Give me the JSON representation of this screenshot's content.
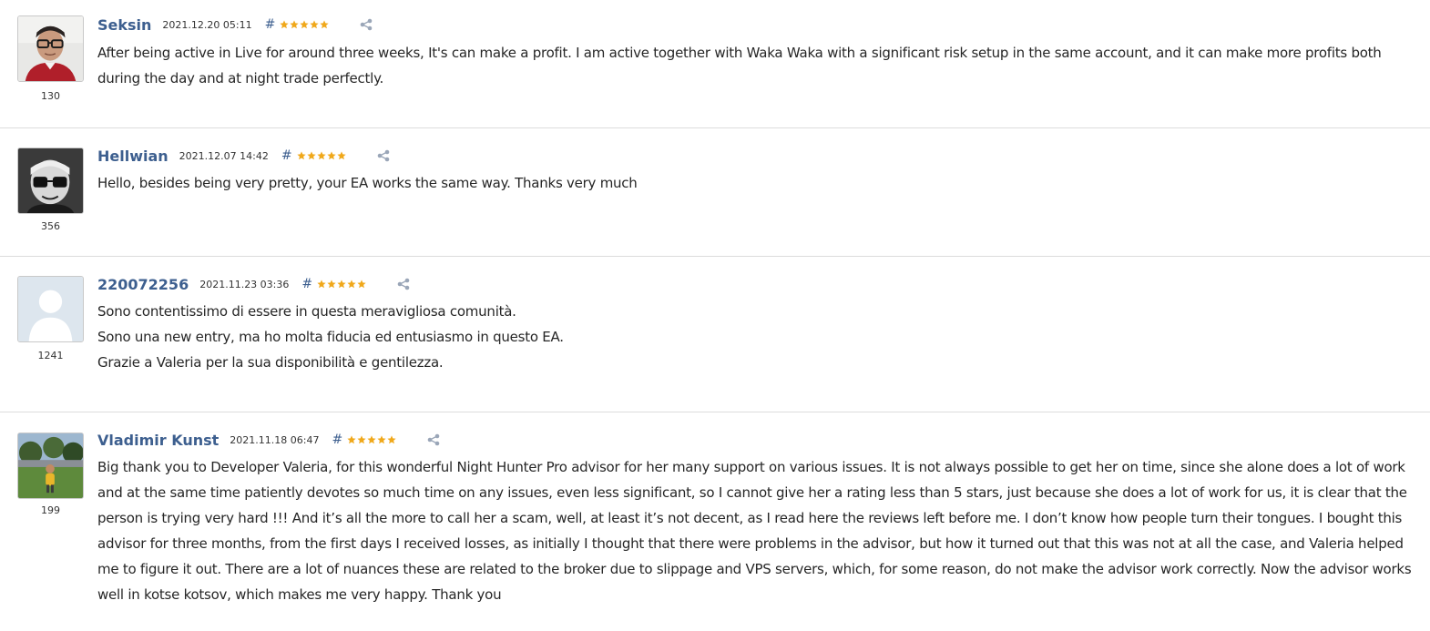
{
  "reviews": [
    {
      "author": "Seksin",
      "date": "2021.12.20 05:11",
      "hash": "#",
      "rating": 5,
      "author_count": "130",
      "avatar_icon": "person-glasses-photo",
      "lines": [
        "After being active in Live for around three weeks, It's can make a profit. I am active together with Waka Waka with a significant risk setup in the same account, and it can make more profits both during the day and at night trade perfectly."
      ]
    },
    {
      "author": "Hellwian",
      "date": "2021.12.07 14:42",
      "hash": "#",
      "rating": 5,
      "author_count": "356",
      "avatar_icon": "bw-portrait-photo",
      "lines": [
        "Hello, besides being very pretty, your EA works the same way. Thanks very much"
      ]
    },
    {
      "author": "220072256",
      "date": "2021.11.23 03:36",
      "hash": "#",
      "rating": 5,
      "author_count": "1241",
      "avatar_icon": "default-user-silhouette",
      "lines": [
        "Sono contentissimo di essere in questa meravigliosa comunità.",
        "Sono una new entry, ma ho molta fiducia ed entusiasmo in questo EA.",
        "Grazie a Valeria per la sua disponibilità e gentilezza."
      ]
    },
    {
      "author": "Vladimir Kunst",
      "date": "2021.11.18 06:47",
      "hash": "#",
      "rating": 5,
      "author_count": "199",
      "avatar_icon": "outdoor-child-photo",
      "lines": [
        "Big thank you to Developer Valeria, for this wonderful Night Hunter Pro advisor for her many support on various issues. It is not always possible to get her on time, since she alone does a lot of work and at the same time patiently devotes so much time on any issues, even less significant, so I cannot give her a rating less than 5 stars, just because she does a lot of work for us, it is clear that the person is trying very hard !!! And it’s all the more to call her a scam, well, at least it’s not decent, as I read here the reviews left before me. I don’t know how people turn their tongues. I bought this advisor for three months, from the first days I received losses, as initially I thought that there were problems in the advisor, but how it turned out that this was not at all the case, and Valeria helped me to figure it out. There are a lot of nuances these are related to the broker due to slippage and VPS servers, which, for some reason, do not make the advisor work correctly. Now the advisor works well in kotse kotsov, which makes me very happy. Thank you"
      ]
    }
  ],
  "colors": {
    "author_link": "#3d5f8f",
    "star": "#f0a81a",
    "share_icon": "#9aa6b8",
    "divider": "#dcdcdc"
  }
}
